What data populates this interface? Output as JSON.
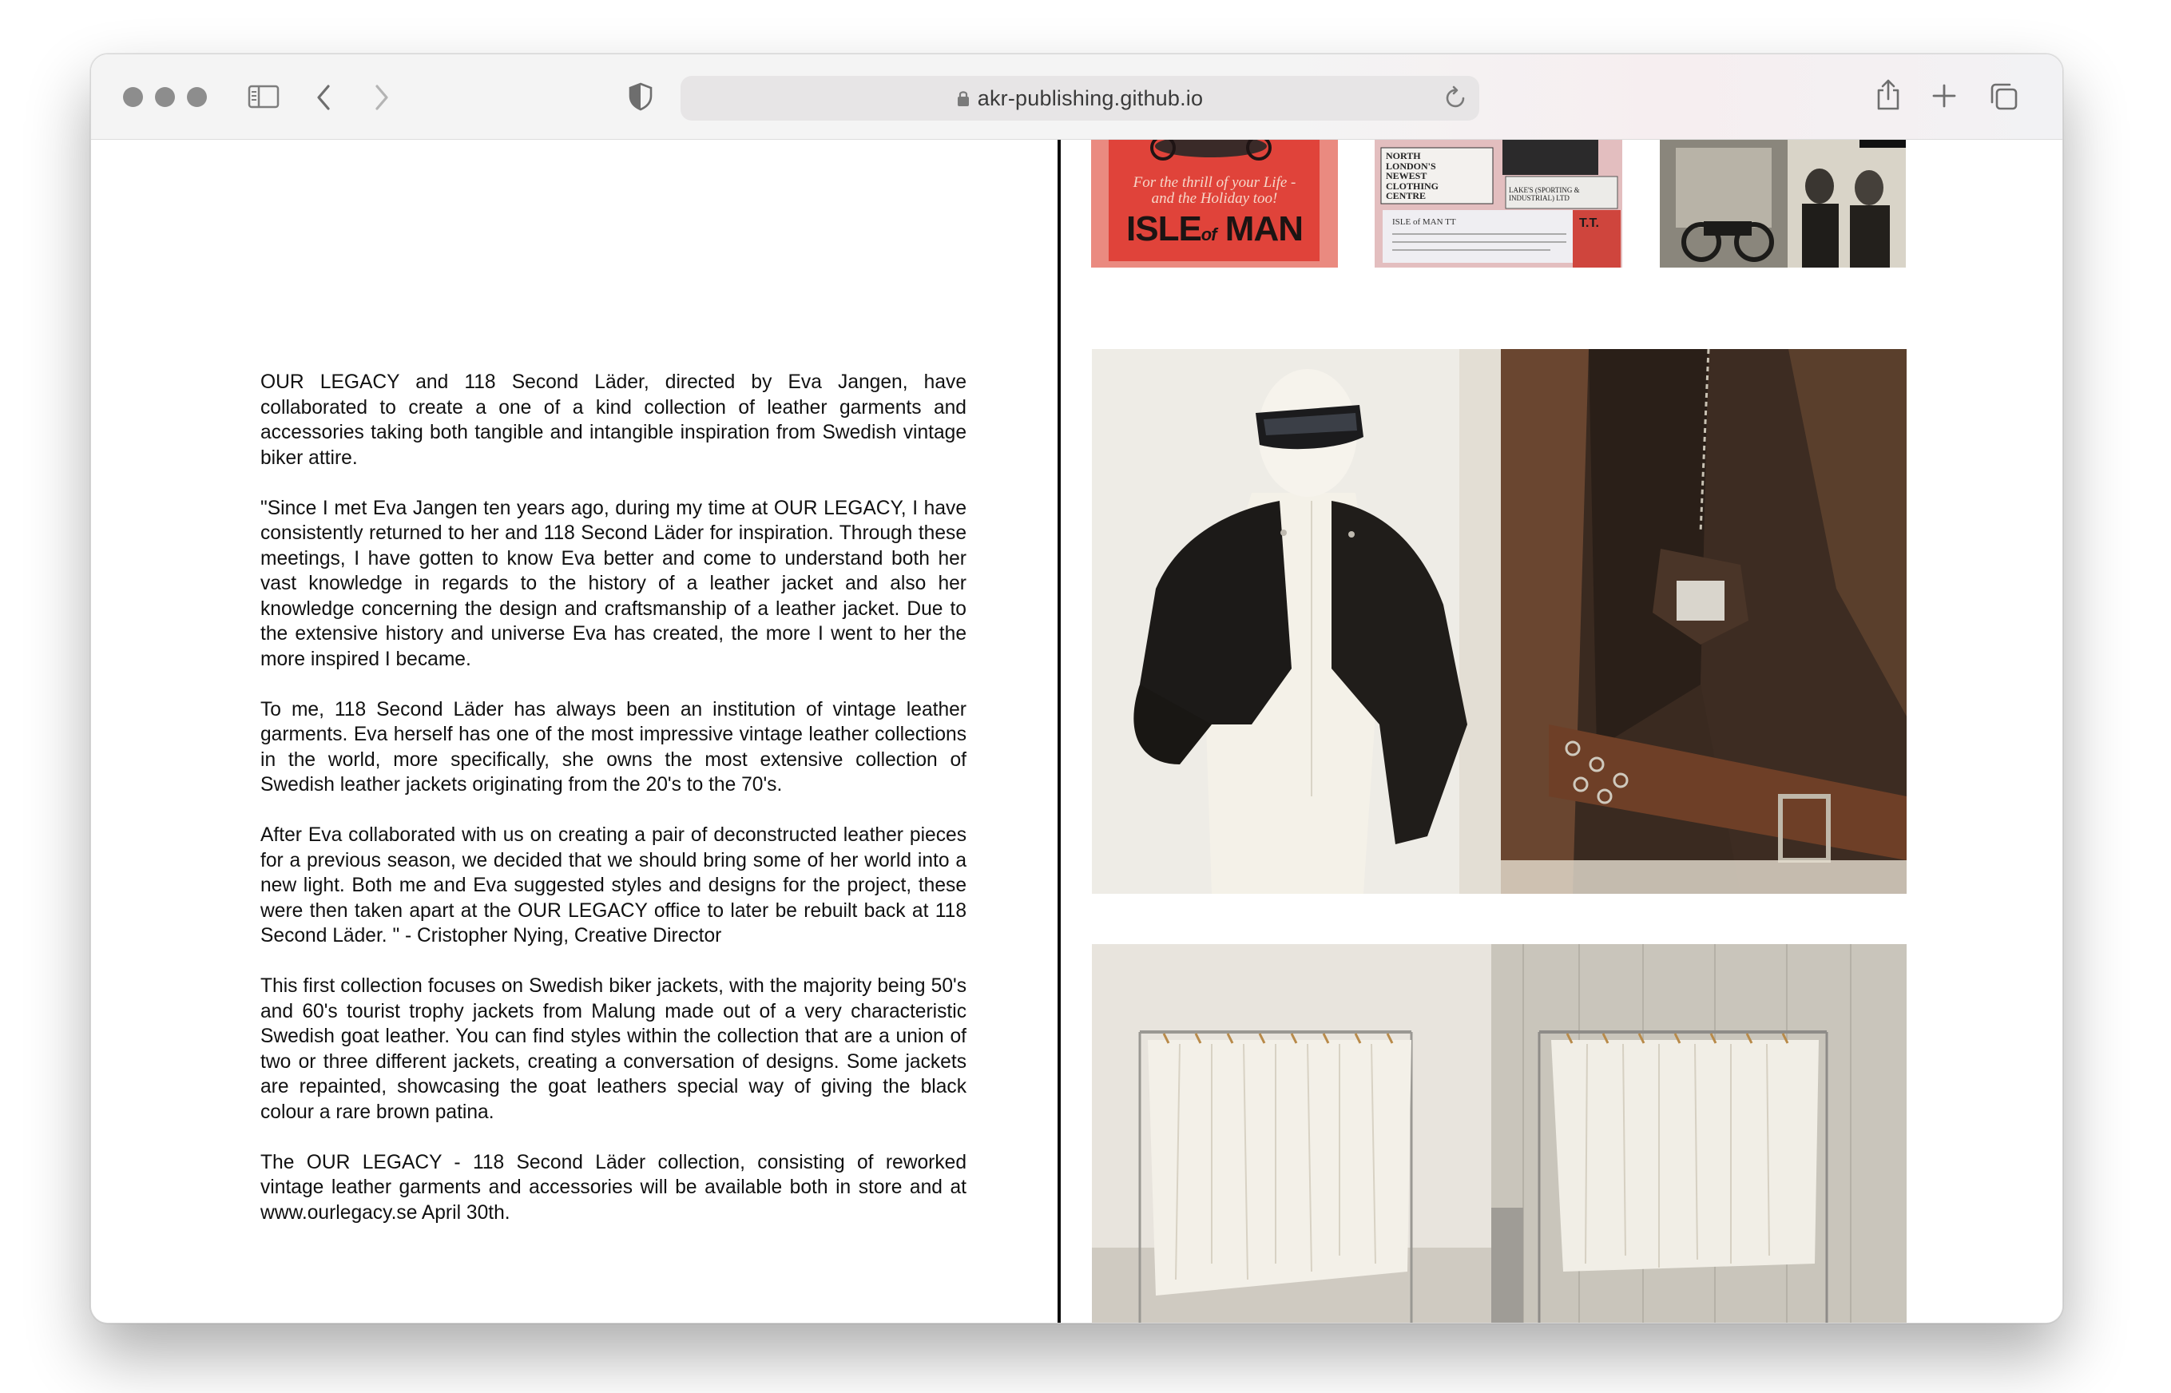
{
  "browser": {
    "url": "akr-publishing.github.io"
  },
  "article": {
    "paragraphs": [
      "OUR LEGACY and 118 Second Läder, directed by Eva Jangen, have collaborated to create a one of a kind collection of leather garments and accessories taking both tangible and intangible inspiration from Swedish vintage biker attire.",
      "\"Since I met Eva Jangen ten years ago, during my time at OUR LEGACY, I have consistently returned to her and 118 Second Läder for inspiration. Through these meetings, I have gotten to know Eva better and come to understand both her vast knowledge in regards to the history of a leather jacket and also her knowledge concerning the design and craftsmanship of a leather jacket. Due to the extensive history and universe Eva has created, the more I went to her the more inspired I became.",
      "To me, 118 Second Läder has always been an institution of vintage leather garments. Eva herself has one of the most impressive vintage leather collections in the world, more specifically, she owns the most extensive collection of Swedish leather jackets originating from the 20's to the 70's.",
      "After Eva collaborated with us on creating a pair of deconstructed leather pieces for a previous season, we decided that we should bring some of her world into a new light. Both me and Eva suggested styles and designs for the project, these were then taken apart at the OUR LEGACY office to later be rebuilt back at 118 Second Läder. \" - Cristopher Nying, Creative Director",
      "This first collection focuses on Swedish biker jackets, with the majority being 50's and 60's tourist trophy jackets from Malung made out of a very characteristic Swedish goat leather. You can find styles within the collection that are a union of two or three different jackets, creating a conversation of designs. Some jackets are repainted, showcasing the goat leathers special way of giving the black colour a rare brown patina.",
      "The OUR LEGACY - 118 Second Läder collection, consisting of reworked vintage leather garments and accessories will be available both in store and at www.ourlegacy.se April 30th."
    ]
  },
  "gallery": {
    "poster_line1": "For the thrill of your Life -",
    "poster_line2": "and the Holiday too!",
    "poster_title_a": "ISLE",
    "poster_title_of": "of",
    "poster_title_b": "MAN",
    "clipping_line1": "NORTH LONDON'S",
    "clipping_line2": "NEWEST",
    "clipping_line3": "CLOTHING",
    "clipping_line4": "CENTRE",
    "clipping_shop": "LAKE'S (SPORTING & INDUSTRIAL) LTD",
    "clipping_heading": "ISLE of MAN TT",
    "clipping_badge": "T.T."
  },
  "colors": {
    "poster_red": "#e0433a",
    "divider": "#0a0a0a"
  }
}
